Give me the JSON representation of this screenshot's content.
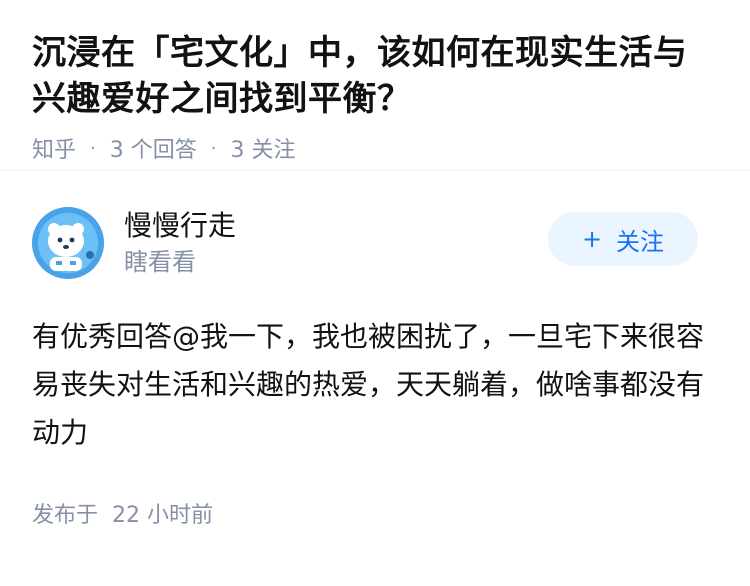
{
  "question": {
    "title": "沉浸在「宅文化」中，该如何在现实生活与兴趣爱好之间找到平衡？",
    "source": "知乎",
    "answer_count": "3 个回答",
    "follow_count": "3 关注"
  },
  "answer": {
    "author_name": "慢慢行走",
    "author_bio": "瞎看看",
    "follow_label": "关注",
    "follow_icon": "plus-icon",
    "content": "有优秀回答@我一下，我也被困扰了，一旦宅下来很容易丧失对生活和兴趣的热爱，天天躺着，做啥事都没有动力",
    "published_label": "发布于",
    "published_time": "22 小时前"
  },
  "colors": {
    "text": "#121212",
    "meta": "#8590a6",
    "accent": "#1772f6",
    "follow_bg": "#ebf5ff",
    "avatar_bg": "#4aa3e8"
  }
}
